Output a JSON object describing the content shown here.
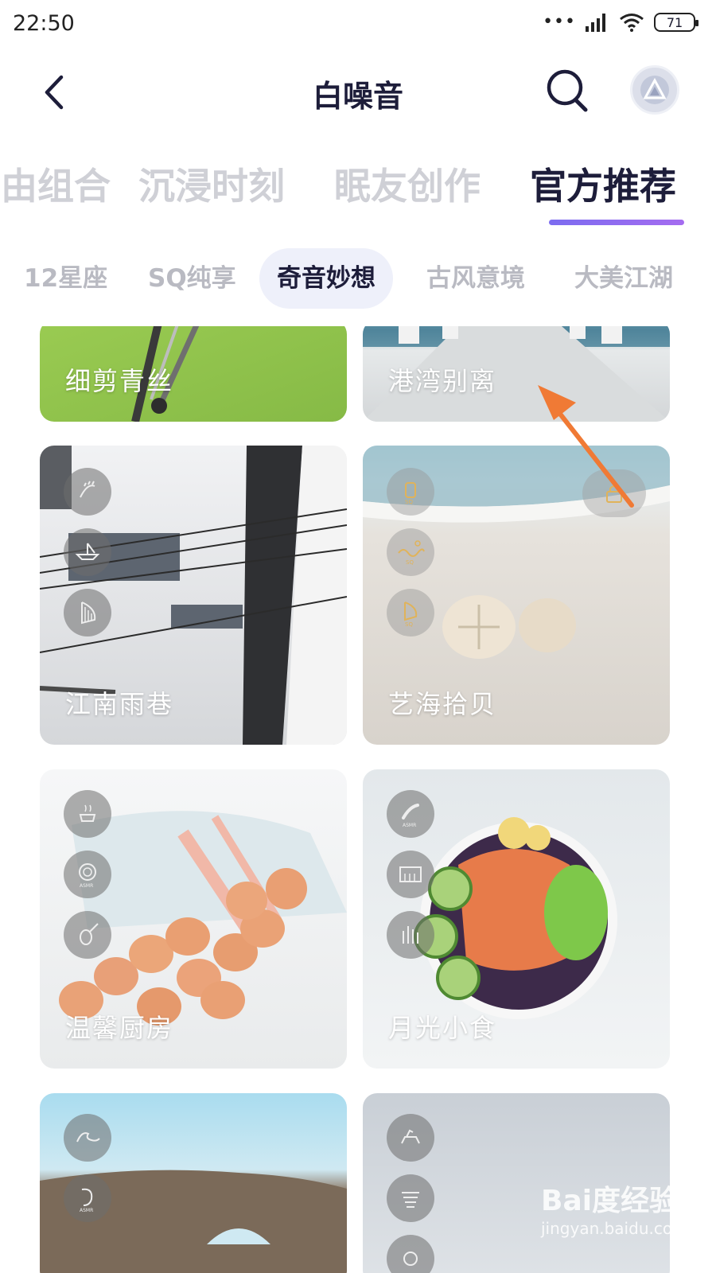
{
  "status_bar": {
    "time": "22:50",
    "signal_dots": "•••",
    "battery": "71"
  },
  "header": {
    "title": "白噪音"
  },
  "main_tabs": [
    {
      "label": "自由组合",
      "active": false
    },
    {
      "label": "沉浸时刻",
      "active": false
    },
    {
      "label": "眠友创作",
      "active": false
    },
    {
      "label": "官方推荐",
      "active": true
    }
  ],
  "sub_tabs": [
    {
      "label": "12星座",
      "active": false
    },
    {
      "label": "SQ纯享",
      "active": false
    },
    {
      "label": "奇音妙想",
      "active": true
    },
    {
      "label": "古风意境",
      "active": false
    },
    {
      "label": "大美江湖",
      "active": false
    }
  ],
  "cards": [
    {
      "title": "细剪青丝"
    },
    {
      "title": "港湾别离"
    },
    {
      "title": "江南雨巷",
      "icons": [
        "rain-icon",
        "paper-boat-icon",
        "harp-icon"
      ]
    },
    {
      "title": "艺海拾贝",
      "icons": [
        "lantern-icon",
        "sea-wave-icon",
        "harp-icon"
      ],
      "locked": true
    },
    {
      "title": "温馨厨房",
      "icons": [
        "steaming-cup-icon",
        "asmr-plate-icon",
        "violin-icon"
      ]
    },
    {
      "title": "月光小食",
      "icons": [
        "cucumber-asmr-icon",
        "piano-icon",
        "grass-icon"
      ]
    },
    {
      "title": "",
      "icons": [
        "ocean-wave-icon",
        "asmr-icon"
      ]
    },
    {
      "title": "",
      "icons": [
        "horse-rider-icon",
        "wind-icon"
      ]
    }
  ],
  "watermark": {
    "main": "Bai度经验",
    "sub": "jingyan.baidu.com"
  },
  "colors": {
    "accent": "#8a6cf0",
    "annotation_arrow": "#f07a35",
    "title": "#1d1d3a"
  }
}
